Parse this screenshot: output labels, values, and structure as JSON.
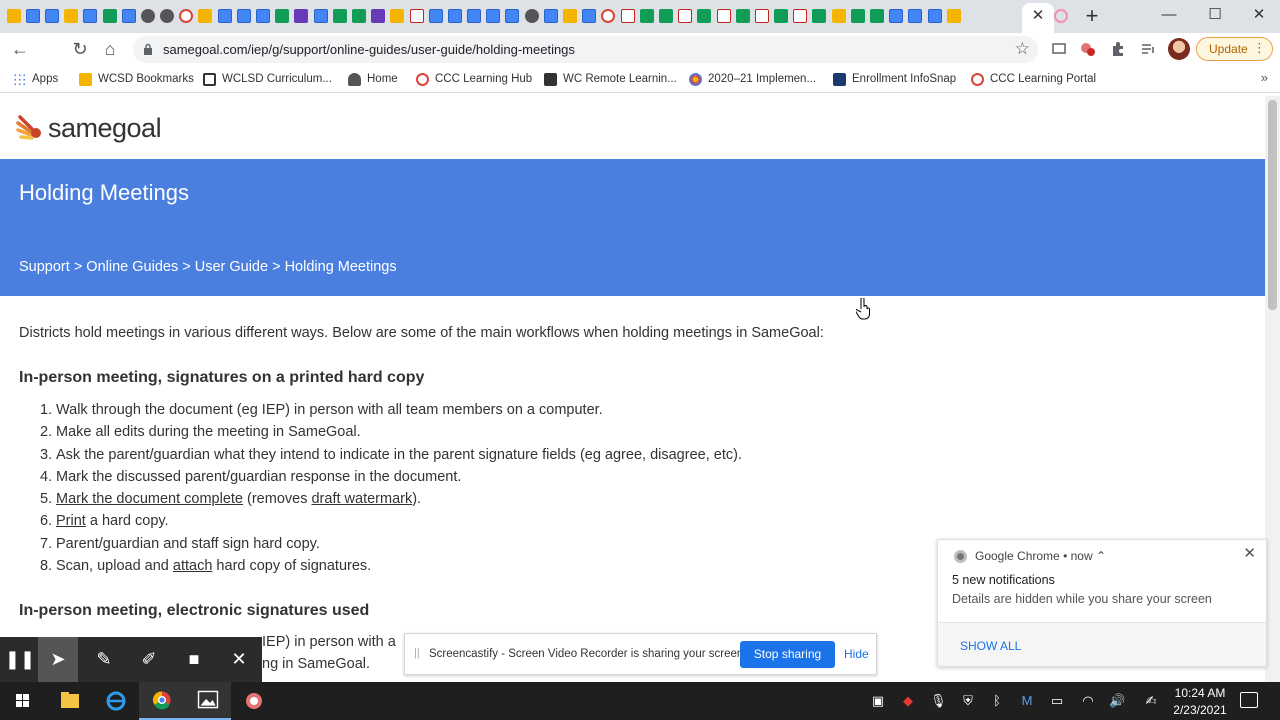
{
  "browser": {
    "new_tab_symbol": "+",
    "tab_close_symbol": "✕",
    "window_controls": {
      "minimize": "—",
      "maximize": "☐",
      "close": "✕"
    },
    "url": "samegoal.com/iep/g/support/online-guides/user-guide/holding-meetings",
    "update_label": "Update",
    "menu_dots": "⋮"
  },
  "bookmarks": [
    {
      "label": "Apps",
      "icon": "apps-grid-icon"
    },
    {
      "label": "WCSD Bookmarks",
      "icon": "folder-icon"
    },
    {
      "label": "WCLSD Curriculum...",
      "icon": "w-logo-icon"
    },
    {
      "label": "Home",
      "icon": "home-icon"
    },
    {
      "label": "CCC Learning Hub",
      "icon": "ccc-hub-icon"
    },
    {
      "label": "WC Remote Learnin...",
      "icon": "wc-icon"
    },
    {
      "label": "2020–21 Implemen...",
      "icon": "sunburst-icon"
    },
    {
      "label": "Enrollment InfoSnap",
      "icon": "enr-icon"
    },
    {
      "label": "CCC Learning Portal",
      "icon": "ccc-portal-icon"
    }
  ],
  "bookmarks_more": "»",
  "site": {
    "logo_text": "samegoal",
    "title": "Holding Meetings",
    "breadcrumb": "Support > Online Guides > User Guide > Holding Meetings",
    "intro": "Districts hold meetings in various different ways. Below are some of the main workflows when holding meetings in SameGoal:"
  },
  "section1": {
    "heading": "In-person meeting, signatures on a printed hard copy",
    "steps": [
      {
        "num": "1.",
        "text": "Walk through the document (eg IEP) in person with all team members on a computer."
      },
      {
        "num": "2.",
        "text": "Make all edits during the meeting in SameGoal."
      },
      {
        "num": "3.",
        "text": "Ask the parent/guardian what they intend to indicate in the parent signature fields (eg agree, disagree, etc)."
      },
      {
        "num": "4.",
        "text": "Mark the discussed parent/guardian response in the document."
      },
      {
        "num": "5.",
        "link1": "Mark the document complete",
        "mid": " (removes ",
        "link2": "draft watermark",
        "end": ")."
      },
      {
        "num": "6.",
        "link1": "Print",
        "end": " a hard copy."
      },
      {
        "num": "7.",
        "text": "Parent/guardian and staff sign hard copy."
      },
      {
        "num": "8.",
        "pre": "Scan, upload and ",
        "link1": "attach",
        "end": " hard copy of signatures."
      }
    ]
  },
  "section2": {
    "heading": "In-person meeting, electronic signatures used",
    "line1_visible": "IEP) in person with a",
    "line2_visible": "ng in SameGoal."
  },
  "notification": {
    "app": "Google Chrome",
    "time": "• now ⌃",
    "title": "5 new notifications",
    "body": "Details are hidden while you share your screen",
    "action": "SHOW ALL"
  },
  "sharebar": {
    "text": "Screencastify - Screen Video Recorder is sharing your screen.",
    "stop_label": "Stop sharing",
    "hide_label": "Hide"
  },
  "taskbar": {
    "time": "10:24 AM",
    "date": "2/23/2021"
  }
}
